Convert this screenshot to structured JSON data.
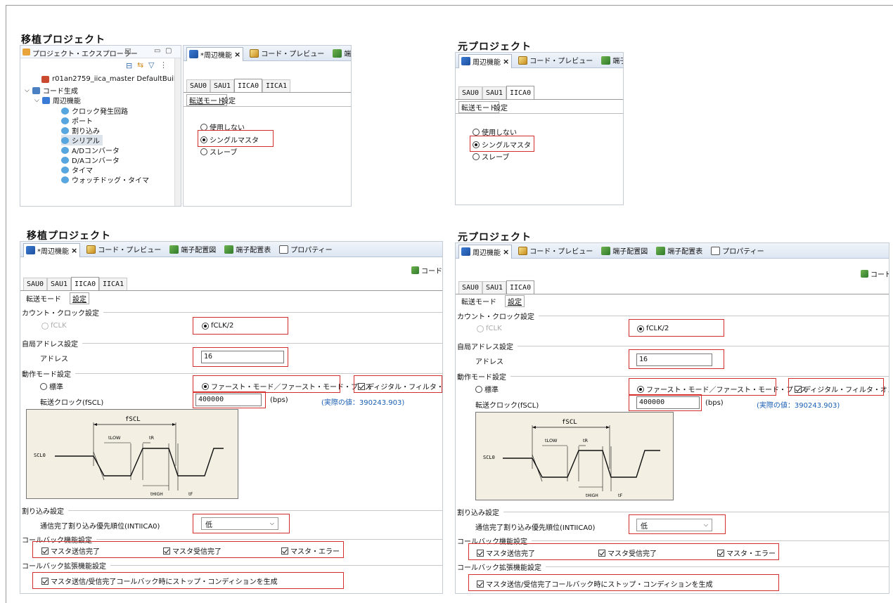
{
  "headings": {
    "top_left": "移植プロジェクト",
    "top_right": "元プロジェクト",
    "bottom_left": "移植プロジェクト",
    "bottom_right": "元プロジェクト"
  },
  "explorer": {
    "title": "プロジェクト・エクスプローラー",
    "close_glyph": "☒",
    "project_row": "r01an2759_iica_master DefaultBuil",
    "code_gen": "コード生成",
    "peripheral": "周辺機能",
    "items": [
      "クロック発生回路",
      "ポート",
      "割り込み",
      "シリアル",
      "A/Dコンバータ",
      "D/Aコンバータ",
      "タイマ",
      "ウォッチドッグ・タイマ"
    ]
  },
  "editor_tabs": {
    "peripheral_modified": "*周辺機能",
    "peripheral": "周辺機能",
    "code_preview": "コード・プレビュー",
    "pin_config_short": "端子配",
    "pin_config_short2": "端子配置",
    "pin_diagram": "端子配置図",
    "pin_table": "端子配置表",
    "property": "プロパティー",
    "close": "×",
    "code_gen_btn": "コードを"
  },
  "periph_tabs": [
    "SAU0",
    "SAU1",
    "IICA0",
    "IICA1"
  ],
  "sub_tabs": {
    "transfer_mode": "転送モード",
    "settings": "設定"
  },
  "transfer_mode": {
    "options": [
      "使用しない",
      "シングルマスタ",
      "スレーブ"
    ],
    "selected": "シングルマスタ"
  },
  "settings": {
    "count_clock_group": "カウント・クロック設定",
    "clock_options": [
      "fCLK",
      "fCLK/2"
    ],
    "clock_selected": "fCLK/2",
    "own_address_group": "自局アドレス設定",
    "address_label": "アドレス",
    "address_value": "16",
    "operation_mode_group": "動作モード設定",
    "mode_standard": "標準",
    "mode_fast": "ファースト・モード／ファースト・モード・プラス",
    "digital_filter": "ディジタル・フィルタ・オン",
    "transfer_clock_label": "転送クロック(fSCL)",
    "transfer_clock_value": "400000",
    "unit": "(bps)",
    "actual_value": "(実際の値：390243.903)",
    "timing": {
      "fscl": "fSCL",
      "tlow": "tLOW",
      "tr": "tR",
      "scl": "SCL0",
      "thigh": "tHIGH",
      "tf": "tF"
    },
    "interrupt_group": "割り込み設定",
    "interrupt_label": "通信完了割り込み優先順位(INTIICA0)",
    "interrupt_value": "低",
    "callback_group": "コールバック機能設定",
    "callbacks": [
      "マスタ送信完了",
      "マスタ受信完了",
      "マスタ・エラー"
    ],
    "callback_ext_group": "コールバック拡張機能設定",
    "callback_ext": "マスタ送信/受信完了コールバック時にストップ・コンディションを生成"
  },
  "colors": {
    "highlight": "#d32f2f",
    "link": "#1a5fb4",
    "tab_bar": "#dde6f2"
  }
}
